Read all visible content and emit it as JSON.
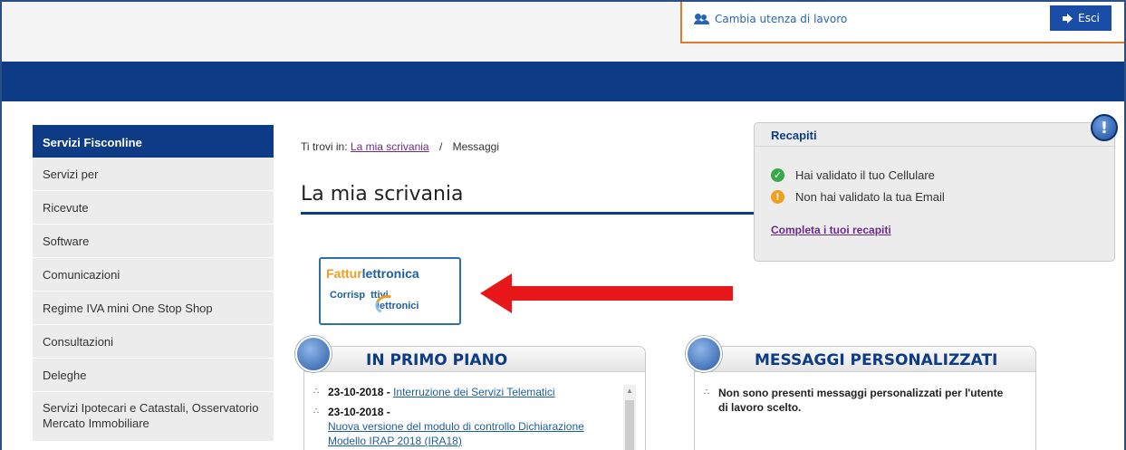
{
  "header": {
    "switch_user_label": "Cambia utenza di lavoro",
    "logout_label": "Esci"
  },
  "sidebar": {
    "title": "Servizi Fisconline",
    "items": [
      {
        "label": "Servizi per"
      },
      {
        "label": "Ricevute"
      },
      {
        "label": "Software"
      },
      {
        "label": "Comunicazioni"
      },
      {
        "label": "Regime IVA mini One Stop Shop"
      },
      {
        "label": "Consultazioni"
      },
      {
        "label": "Deleghe"
      },
      {
        "label": "Servizi Ipotecari e Catastali, Osservatorio Mercato Immobiliare"
      }
    ]
  },
  "breadcrumb": {
    "prefix": "Ti trovi in:",
    "link": "La mia scrivania",
    "separator": "/",
    "current": "Messaggi"
  },
  "page_title": "La mia scrivania",
  "banner": {
    "line1_a": "Fattur",
    "line1_b": "lettronica",
    "line2_a": "Corrisp",
    "line2_b": "ttivi",
    "line2_c": "lettronici"
  },
  "recapiti": {
    "title": "Recapiti",
    "phone_status": "Hai validato il tuo Cellulare",
    "email_status": "Non hai validato la tua Email",
    "complete_link": "Completa i tuoi recapiti",
    "alert_symbol": "!"
  },
  "in_primo_piano": {
    "title": "IN PRIMO PIANO",
    "news": [
      {
        "date": "23-10-2018 -",
        "link": "Interruzione dei Servizi Telematici"
      },
      {
        "date": "23-10-2018 -",
        "link": "Nuova versione del modulo di controllo Dichiarazione Modello IRAP 2018 (IRA18)"
      }
    ]
  },
  "messaggi_personalizzati": {
    "title": "MESSAGGI PERSONALIZZATI",
    "text": "Non sono presenti messaggi personalizzati per l'utente di lavoro scelto."
  },
  "colors": {
    "nav_blue": "#0e3b85",
    "accent_orange": "#e07a2a",
    "arrow_red": "#e8181a",
    "link_purple": "#6b2c88"
  }
}
